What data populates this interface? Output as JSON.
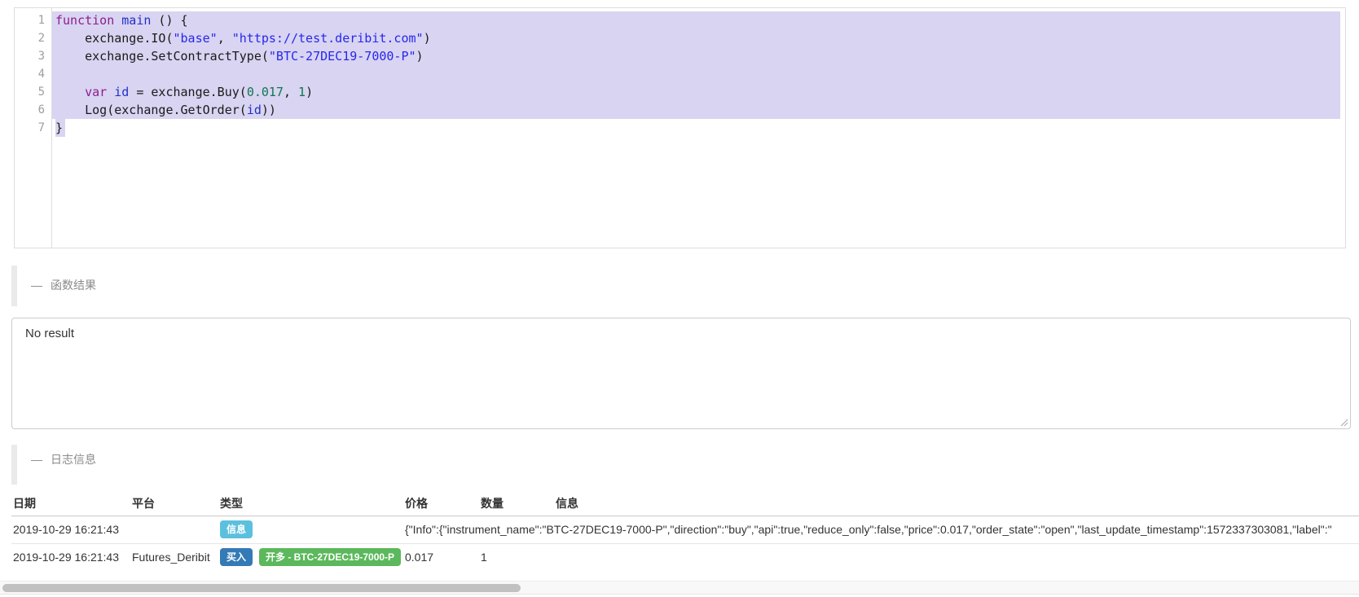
{
  "colors": {
    "selection": "#d8d4f1",
    "syntax_keyword": "#8f1d8f",
    "syntax_def": "#2230c8",
    "syntax_string": "#2727ee",
    "syntax_number": "#117653",
    "badge_info": "#5bc0de",
    "badge_buy": "#337ab7",
    "badge_long": "#5cb85c"
  },
  "editor": {
    "lines": [
      {
        "num": "1",
        "selected": "full",
        "tokens": [
          {
            "t": "function",
            "c": "kw"
          },
          {
            "t": " ",
            "c": ""
          },
          {
            "t": "main",
            "c": "def"
          },
          {
            "t": " () {",
            "c": ""
          }
        ]
      },
      {
        "num": "2",
        "selected": "full",
        "tokens": [
          {
            "t": "    exchange.IO(",
            "c": ""
          },
          {
            "t": "\"base\"",
            "c": "str"
          },
          {
            "t": ", ",
            "c": ""
          },
          {
            "t": "\"https://test.deribit.com\"",
            "c": "str"
          },
          {
            "t": ")",
            "c": ""
          }
        ]
      },
      {
        "num": "3",
        "selected": "full",
        "tokens": [
          {
            "t": "    exchange.SetContractType(",
            "c": ""
          },
          {
            "t": "\"BTC-27DEC19-7000-P\"",
            "c": "str"
          },
          {
            "t": ")",
            "c": ""
          }
        ]
      },
      {
        "num": "4",
        "selected": "full",
        "tokens": []
      },
      {
        "num": "5",
        "selected": "full",
        "tokens": [
          {
            "t": "    ",
            "c": ""
          },
          {
            "t": "var",
            "c": "kw"
          },
          {
            "t": " ",
            "c": ""
          },
          {
            "t": "id",
            "c": "def"
          },
          {
            "t": " = exchange.Buy(",
            "c": ""
          },
          {
            "t": "0.017",
            "c": "num"
          },
          {
            "t": ", ",
            "c": ""
          },
          {
            "t": "1",
            "c": "num"
          },
          {
            "t": ")",
            "c": ""
          }
        ]
      },
      {
        "num": "6",
        "selected": "full",
        "tokens": [
          {
            "t": "    Log(exchange.GetOrder(",
            "c": ""
          },
          {
            "t": "id",
            "c": "def"
          },
          {
            "t": "))",
            "c": ""
          }
        ]
      },
      {
        "num": "7",
        "selected": "char",
        "tokens": [
          {
            "t": "}",
            "c": ""
          }
        ]
      }
    ]
  },
  "sections": {
    "function_result": {
      "toggle": "—",
      "label": "函数结果"
    },
    "log_info": {
      "toggle": "—",
      "label": "日志信息"
    }
  },
  "result_box": {
    "value": "No result"
  },
  "log_table": {
    "headers": [
      "日期",
      "平台",
      "类型",
      "价格",
      "数量",
      "信息"
    ],
    "rows": [
      {
        "date": "2019-10-29 16:21:43",
        "platform": "",
        "badges": [
          {
            "text": "信息",
            "color": "#5bc0de"
          }
        ],
        "message_span": true,
        "price": "",
        "qty": "",
        "message": "{\"Info\":{\"instrument_name\":\"BTC-27DEC19-7000-P\",\"direction\":\"buy\",\"api\":true,\"reduce_only\":false,\"price\":0.017,\"order_state\":\"open\",\"last_update_timestamp\":1572337303081,\"label\":\""
      },
      {
        "date": "2019-10-29 16:21:43",
        "platform": "Futures_Deribit",
        "badges": [
          {
            "text": "买入",
            "color": "#337ab7"
          },
          {
            "text": "开多 - BTC-27DEC19-7000-P",
            "color": "#5cb85c"
          }
        ],
        "message_span": false,
        "price": "0.017",
        "qty": "1",
        "message": ""
      }
    ]
  }
}
